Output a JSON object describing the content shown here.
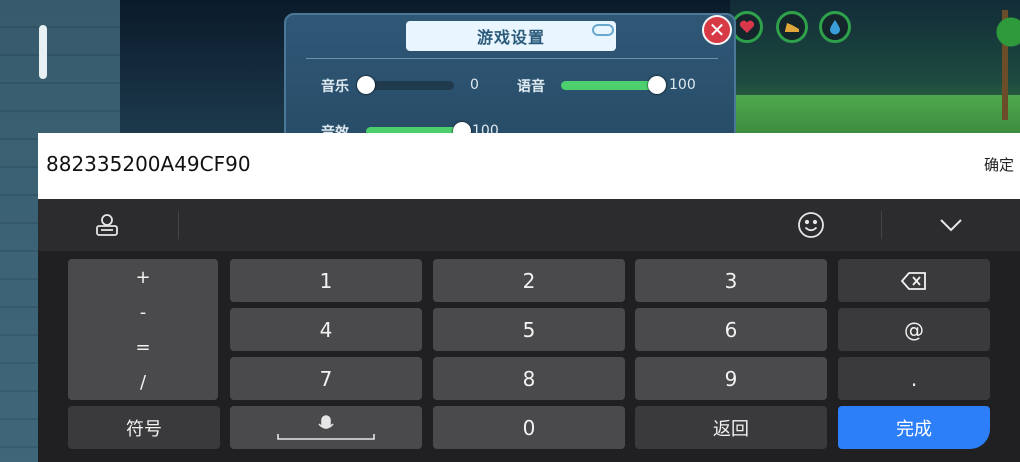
{
  "game": {
    "settings": {
      "title": "游戏设置",
      "close_label": "✕",
      "music": {
        "label": "音乐",
        "value": "0",
        "level": 0
      },
      "voice": {
        "label": "语音",
        "value": "100",
        "level": 100
      },
      "sfx": {
        "label": "音效",
        "value": "100",
        "level": 100
      }
    },
    "status_icons": [
      "heart-icon",
      "shoe-icon",
      "water-drop-icon"
    ],
    "colors": {
      "slider_fill": "#4ccf6c",
      "close": "#d83a45",
      "panel": "#2f5877"
    }
  },
  "input": {
    "value": "882335200A49CF90",
    "confirm_label": "确定"
  },
  "keyboard": {
    "toolbar_icons": [
      "keyboard-settings-icon",
      "emoji-icon",
      "collapse-chevron-icon"
    ],
    "symbols": [
      "+",
      "-",
      "=",
      "/"
    ],
    "digits": [
      "1",
      "2",
      "3",
      "4",
      "5",
      "6",
      "7",
      "8",
      "9",
      "0"
    ],
    "at_label": "@",
    "dot_label": ".",
    "symbol_label": "符号",
    "back_label": "返回",
    "done_label": "完成",
    "done_color": "#2d7ff9"
  }
}
